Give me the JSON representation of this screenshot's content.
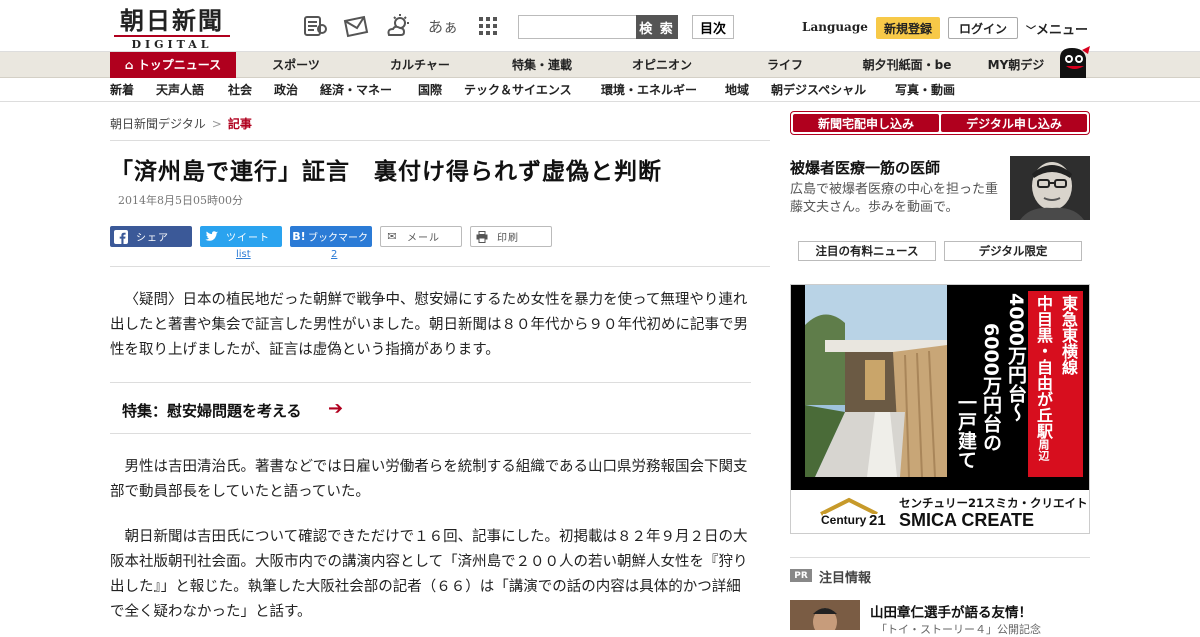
{
  "logo": {
    "name": "朝日新聞",
    "sub": "DIGITAL"
  },
  "toolbar": {
    "icons": [
      "newspaper-icon",
      "mail-icon",
      "weather-icon",
      "font-size-icon",
      "grid-icon"
    ],
    "font_icon_text": "あぁ",
    "search_placeholder": "",
    "search_label": "検 索",
    "index_label": "目次",
    "language_label": "Language",
    "register_label": "新規登録",
    "login_label": "ログイン",
    "menu_label": "メニュー"
  },
  "nav_main": [
    {
      "label": "トップニュース"
    },
    {
      "label": "スポーツ"
    },
    {
      "label": "カルチャー"
    },
    {
      "label": "特集・連載"
    },
    {
      "label": "オピニオン"
    },
    {
      "label": "ライフ"
    },
    {
      "label": "朝夕刊紙面・be"
    },
    {
      "label": "MY朝デジ"
    }
  ],
  "nav_sub": [
    {
      "label": "新着"
    },
    {
      "label": "天声人語"
    },
    {
      "label": "社会"
    },
    {
      "label": "政治"
    },
    {
      "label": "経済・マネー"
    },
    {
      "label": "国際"
    },
    {
      "label": "テック＆サイエンス"
    },
    {
      "label": "環境・エネルギー"
    },
    {
      "label": "地域"
    },
    {
      "label": "朝デジスペシャル"
    },
    {
      "label": "写真・動画"
    }
  ],
  "breadcrumb": {
    "home": "朝日新聞デジタル",
    "sep": ">",
    "current": "記事"
  },
  "article": {
    "title": "「済州島で連行」証言　裏付け得られず虚偽と判断",
    "date": "2014年8月5日05時00分",
    "share": {
      "facebook": "シェア",
      "twitter": "ツイート",
      "twitter_count": "list",
      "hatena": "ブックマーク",
      "hatena_icon": "B!",
      "hatena_count": "2",
      "mail": "メール",
      "print": "印刷"
    },
    "lead": "〈疑問〉日本の植民地だった朝鮮で戦争中、慰安婦にするため女性を暴力を使って無理やり連れ出したと著書や集会で証言した男性がいました。朝日新聞は８０年代から９０年代初めに記事で男性を取り上げましたが、証言は虚偽という指摘があります。",
    "feature_link": "特集：慰安婦問題を考える",
    "body_1": "男性は吉田清治氏。著書などでは日雇い労働者らを統制する組織である山口県労務報国会下関支部で動員部長をしていたと語っていた。",
    "body_2": "朝日新聞は吉田氏について確認できただけで１６回、記事にした。初掲載は８２年９月２日の大阪本社版朝刊社会面。大阪市内での講演内容として「済州島で２００人の若い朝鮮人女性を『狩り出した』」と報じた。執筆した大阪社会部の記者（６６）は「講演での話の内容は具体的かつ詳細で全く疑わなかった」と話す。"
  },
  "sidebar": {
    "subscribe_paper": "新聞宅配申し込み",
    "subscribe_digital": "デジタル申し込み",
    "promo_title": "被爆者医療一筋の医師",
    "promo_desc": "広島で被爆者医療の中心を担った重藤文夫さん。歩みを動画で。",
    "tab_paid": "注目の有料ニュース",
    "tab_digital": "デジタル限定",
    "ad": {
      "line_red": "東急東横線",
      "line_red2": "中目黒・自由が丘駅",
      "line_red2_small": "周辺",
      "price": "4000万円台～",
      "price2": "6000万円台の",
      "house": "一戸建て",
      "brand_jp": "センチュリー21スミカ・クリエイト",
      "brand_en": "SMICA CREATE",
      "brand_logo": "Century21"
    },
    "pr_badge": "PR",
    "pr_label": "注目情報",
    "pr_title": "山田章仁選手が語る友情！",
    "pr_sub": "「トイ・ストーリー４」公開記念"
  },
  "colors": {
    "brand": "#b0001e",
    "facebook": "#3b5998",
    "twitter": "#2aa3ef",
    "hatena": "#2b7bd6",
    "register": "#f7c948"
  }
}
